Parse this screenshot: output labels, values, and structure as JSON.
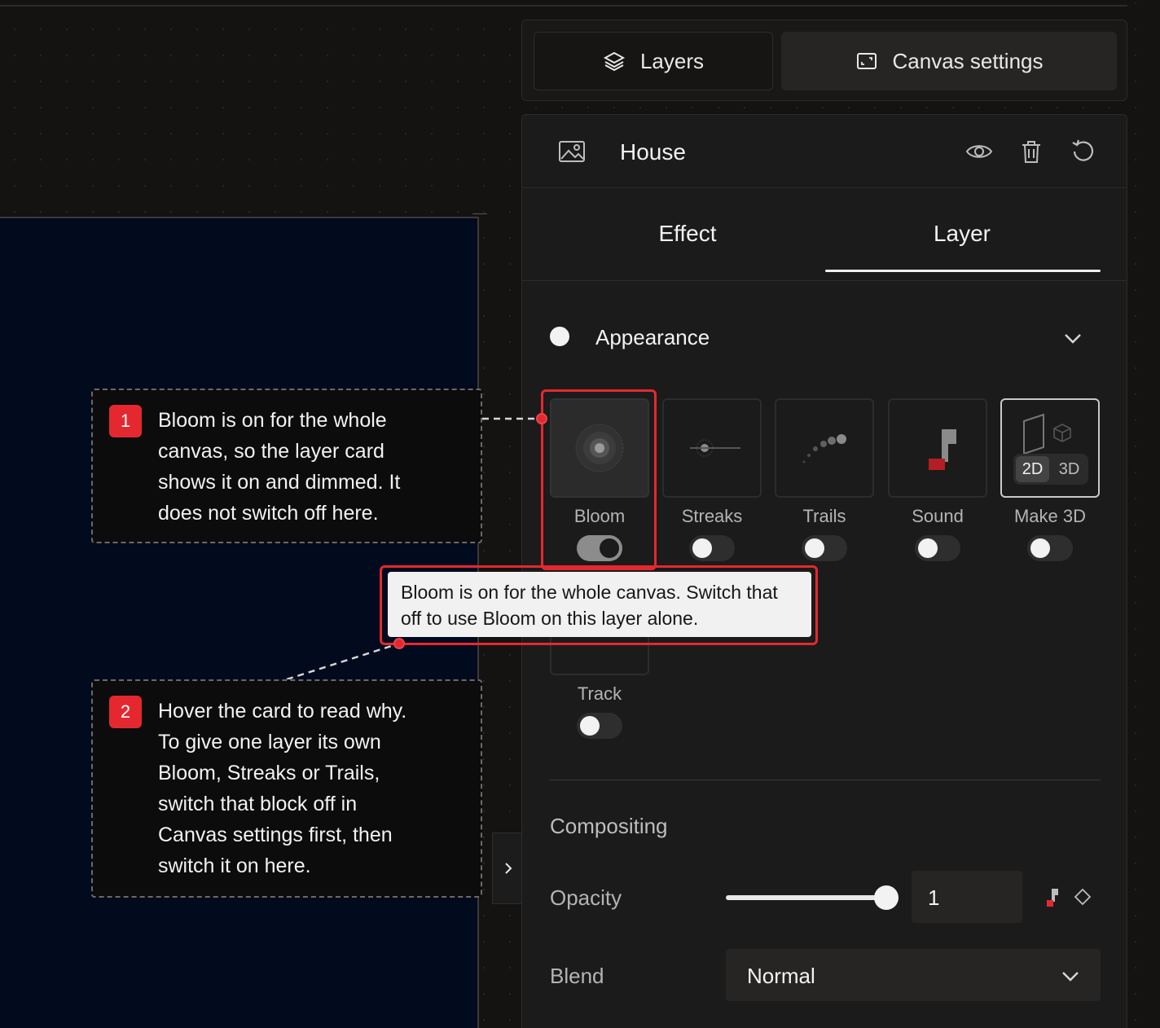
{
  "panel_tabs": {
    "layers": "Layers",
    "canvas_settings": "Canvas settings"
  },
  "layer": {
    "name": "House"
  },
  "subtabs": {
    "effect": "Effect",
    "layer": "Layer"
  },
  "appearance": {
    "title": "Appearance",
    "cards": [
      {
        "label": "Bloom",
        "on": true,
        "dimmed": true
      },
      {
        "label": "Streaks",
        "on": false
      },
      {
        "label": "Trails",
        "on": false
      },
      {
        "label": "Sound",
        "on": false
      },
      {
        "label": "Make 3D",
        "on": false,
        "segment": [
          "2D",
          "3D"
        ],
        "segment_selected": "2D"
      }
    ],
    "track": {
      "label": "Track",
      "on": false
    }
  },
  "tooltip": "Bloom is on for the whole canvas. Switch that off to use Bloom on this layer alone.",
  "compositing": {
    "title": "Compositing",
    "opacity_label": "Opacity",
    "opacity_value": "1",
    "opacity_slider_fraction": 1.0,
    "blend_label": "Blend",
    "blend_value": "Normal"
  },
  "callouts": [
    {
      "number": "1",
      "text": "Bloom is on for the whole\ncanvas, so the layer card\nshows it on and dimmed. It\ndoes not switch off here."
    },
    {
      "number": "2",
      "text": "Hover the card to read why.\nTo give one layer its own\nBloom, Streaks or Trails,\nswitch that block off in\nCanvas settings first, then\nswitch it on here."
    }
  ],
  "colors": {
    "accent": "#e5282f",
    "panel": "#1b1b1b",
    "canvas": "#020a1e",
    "tooltip_bg": "#f1f1f1"
  }
}
